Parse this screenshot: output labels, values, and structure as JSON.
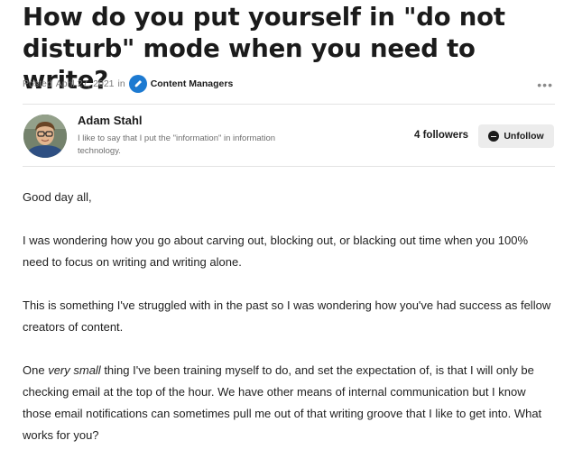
{
  "post": {
    "title": "How do you put yourself in \"do not disturb\" mode when you need to write?",
    "posted_prefix": "Posted",
    "date": "April 27, 2021",
    "in_word": "in",
    "group": "Content Managers",
    "more_label": "•••"
  },
  "author": {
    "name": "Adam Stahl",
    "bio": "I like to say that I put the \"information\" in information technology.",
    "followers": "4 followers",
    "unfollow_label": "Unfollow"
  },
  "body": {
    "p1": "Good day all,",
    "p2": "I was wondering how you go about carving out, blocking out, or blacking out time when you 100% need to focus on writing and writing alone.",
    "p3": "This is something I've struggled with in the past so I was wondering how you've had success as fellow creators of content.",
    "p4_start": "One ",
    "p4_em": "very small",
    "p4_rest": " thing I've been training myself to do, and set the expectation of, is that I will only be checking email at the top of the hour. We have other means of internal communication but I know those email notifications can sometimes pull me out of that writing groove that I like to get into. What works for you?"
  },
  "colors": {
    "accent": "#1d7ad1",
    "button_bg": "#ececec",
    "divider": "#e3e3e3"
  },
  "icons": [
    "pen-icon",
    "more-options-icon",
    "minus-circle-icon"
  ]
}
